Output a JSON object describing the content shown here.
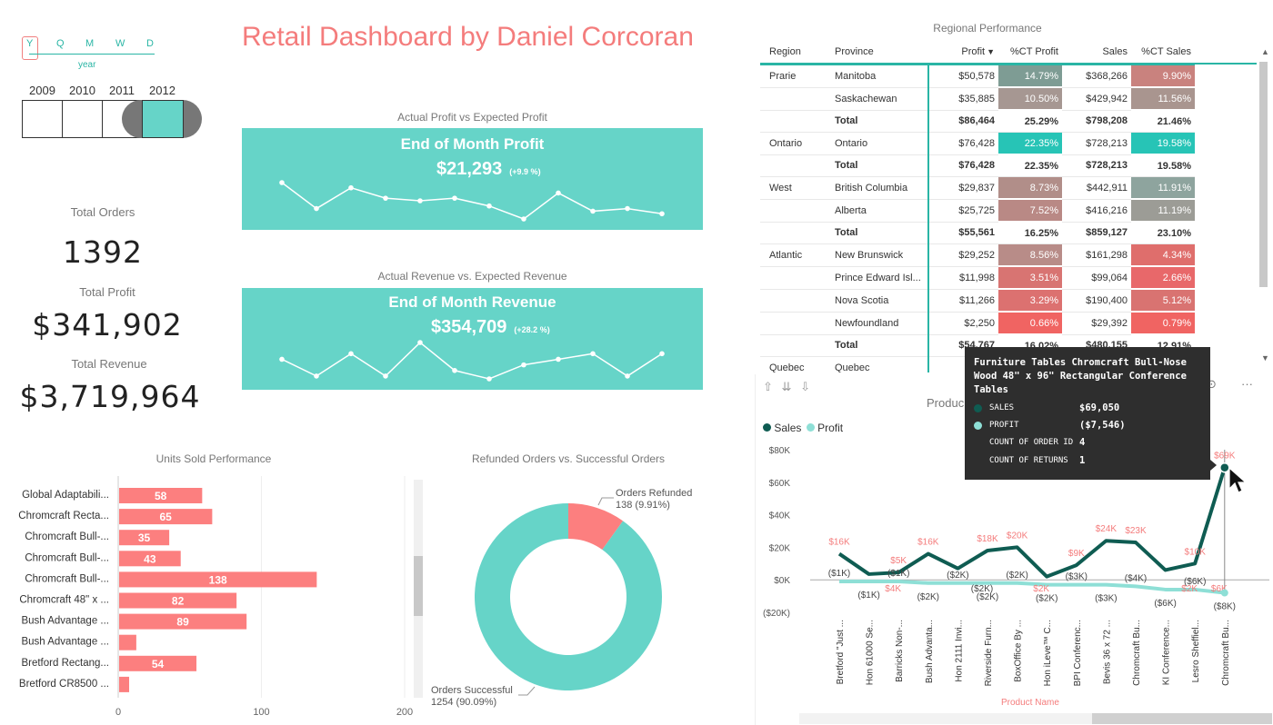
{
  "title": "Retail Dashboard by Daniel Corcoran",
  "time_slicer": {
    "levels": [
      "Y",
      "Q",
      "M",
      "W",
      "D"
    ],
    "level_caption": "year",
    "years": [
      "2009",
      "2010",
      "2011",
      "2012"
    ],
    "selected_year": "2012"
  },
  "kpis": {
    "orders_label": "Total Orders",
    "orders_value": "1392",
    "profit_label": "Total Profit",
    "profit_value": "$341,902",
    "revenue_label": "Total Revenue",
    "revenue_value": "$3,719,964"
  },
  "profit_card": {
    "caption": "Actual Profit vs Expected Profit",
    "heading": "End of Month Profit",
    "value": "$21,293",
    "change": "(+9.9 %)",
    "trend": [
      8,
      3,
      7,
      5,
      4.5,
      5,
      3.5,
      1,
      6,
      2.5,
      3,
      2
    ]
  },
  "revenue_card": {
    "caption": "Actual Revenue vs. Expected Revenue",
    "heading": "End of Month Revenue",
    "value": "$354,709",
    "change": "(+28.2 %)",
    "trend": [
      5,
      2,
      6,
      2,
      8,
      3,
      1.5,
      4,
      5,
      6,
      2,
      6
    ]
  },
  "regional": {
    "title": "Regional Performance",
    "headers": [
      "Region",
      "Province",
      "Profit",
      "%CT Profit",
      "Sales",
      "%CT Sales"
    ],
    "rows": [
      {
        "region": "Prarie",
        "province": "Manitoba",
        "profit": "$50,578",
        "ctp": "14.79%",
        "sales": "$368,266",
        "cts": "9.90%",
        "cp": "#7e9c94",
        "cs": "#c9827e"
      },
      {
        "region": "",
        "province": "Saskachewan",
        "profit": "$35,885",
        "ctp": "10.50%",
        "sales": "$429,942",
        "cts": "11.56%",
        "cp": "#a69792",
        "cs": "#a9958f"
      },
      {
        "region": "",
        "province": "Total",
        "profit": "$86,464",
        "ctp": "25.29%",
        "sales": "$798,208",
        "cts": "21.46%",
        "total": true
      },
      {
        "region": "Ontario",
        "province": "Ontario",
        "profit": "$76,428",
        "ctp": "22.35%",
        "sales": "$728,213",
        "cts": "19.58%",
        "cp": "#27c4b6",
        "cs": "#27c4b6"
      },
      {
        "region": "",
        "province": "Total",
        "profit": "$76,428",
        "ctp": "22.35%",
        "sales": "$728,213",
        "cts": "19.58%",
        "total": true
      },
      {
        "region": "West",
        "province": "British Columbia",
        "profit": "$29,837",
        "ctp": "8.73%",
        "sales": "$442,911",
        "cts": "11.91%",
        "cp": "#b18e89",
        "cs": "#8ea49e"
      },
      {
        "region": "",
        "province": "Alberta",
        "profit": "$25,725",
        "ctp": "7.52%",
        "sales": "$416,216",
        "cts": "11.19%",
        "cp": "#b98985",
        "cs": "#9c9c96"
      },
      {
        "region": "",
        "province": "Total",
        "profit": "$55,561",
        "ctp": "16.25%",
        "sales": "$859,127",
        "cts": "23.10%",
        "total": true
      },
      {
        "region": "Atlantic",
        "province": "New Brunswick",
        "profit": "$29,252",
        "ctp": "8.56%",
        "sales": "$161,298",
        "cts": "4.34%",
        "cp": "#b88c88",
        "cs": "#df6e6c"
      },
      {
        "region": "",
        "province": "Prince Edward Isl...",
        "profit": "$11,998",
        "ctp": "3.51%",
        "sales": "$99,064",
        "cts": "2.66%",
        "cp": "#d87472",
        "cs": "#e8686a"
      },
      {
        "region": "",
        "province": "Nova Scotia",
        "profit": "$11,266",
        "ctp": "3.29%",
        "sales": "$190,400",
        "cts": "5.12%",
        "cp": "#dc7170",
        "cs": "#d97371"
      },
      {
        "region": "",
        "province": "Newfoundland",
        "profit": "$2,250",
        "ctp": "0.66%",
        "sales": "$29,392",
        "cts": "0.79%",
        "cp": "#f06462",
        "cs": "#f06462"
      },
      {
        "region": "",
        "province": "Total",
        "profit": "$54,767",
        "ctp": "16.02%",
        "sales": "$480,155",
        "cts": "12.91%",
        "total": true
      },
      {
        "region": "Quebec",
        "province": "Quebec",
        "profit": "",
        "ctp": "",
        "sales": "",
        "cts": ""
      }
    ]
  },
  "units_sold": {
    "title": "Units Sold Performance",
    "chart_data": {
      "type": "bar",
      "categories": [
        "Global Adaptabili...",
        "Chromcraft Recta...",
        "Chromcraft Bull-...",
        "Chromcraft Bull-...",
        "Chromcraft Bull-...",
        "Chromcraft 48\" x ...",
        "Bush Advantage ...",
        "Bush Advantage ...",
        "Bretford Rectang...",
        "Bretford CR8500 ..."
      ],
      "values": [
        58,
        65,
        35,
        43,
        138,
        82,
        89,
        12,
        54,
        7
      ],
      "data_labels": [
        "58",
        "65",
        "35",
        "43",
        "138",
        "82",
        "89",
        "",
        "54",
        ""
      ],
      "xlim": [
        0,
        200
      ],
      "ticks": [
        "0",
        "100",
        "200"
      ],
      "color": "#fc7f7f"
    }
  },
  "refunds": {
    "title": "Refunded Orders vs. Successful Orders",
    "chart_data": {
      "type": "pie",
      "labels": [
        "Orders Refunded",
        "Orders Successful"
      ],
      "values": [
        138,
        1254
      ],
      "display": [
        "138 (9.91%)",
        "1254 (90.09%)"
      ],
      "colors": [
        "#fc7f7f",
        "#66d4c8"
      ]
    }
  },
  "product_chart": {
    "title": "Produc",
    "legend": [
      "Sales",
      "Profit"
    ],
    "colors": {
      "sales": "#0f5c52",
      "profit": "#8edfd6"
    },
    "y_ticks": [
      "$80K",
      "$60K",
      "$40K",
      "$20K",
      "$0K",
      "($20K)"
    ],
    "x_title": "Product Name",
    "chart_data": {
      "type": "line",
      "categories": [
        "Bretford \"Just ...",
        "Hon 61000 Se...",
        "Barricks Non-...",
        "Bush Advanta...",
        "Hon 2111 Invi...",
        "Riverside Furn...",
        "BoxOffice By ...",
        "Hon iLeve™ C...",
        "BPI Conferenc...",
        "Bevis 36 x 72 ...",
        "Chromcraft Bu...",
        "KI Conference...",
        "Lesro Sheffiel...",
        "Chromcraft Bu..."
      ],
      "series": [
        {
          "name": "Sales",
          "values": [
            16,
            3.5,
            4.5,
            16,
            7,
            18,
            20,
            2,
            9,
            24,
            23,
            6,
            10,
            69
          ],
          "labels": [
            "$16K",
            "",
            "$5K",
            "$16K",
            "",
            "$18K",
            "$20K",
            "",
            "$9K",
            "$24K",
            "$23K",
            "",
            "$10K",
            "$69K"
          ]
        },
        {
          "name": "Profit",
          "values": [
            -1,
            -1,
            -1,
            -2,
            -2,
            -2,
            -2,
            -3,
            -3,
            -3,
            -4,
            -6,
            -6,
            -8
          ],
          "labels": [
            "($1K)",
            "($1K)",
            "($1K)",
            "($2K)",
            "($2K)",
            "($2K)",
            "($2K)",
            "($2K)",
            "($3K)",
            "($3K)",
            "($4K)",
            "($6K)",
            "($6K)",
            "($8K)"
          ]
        }
      ],
      "extra_labels": [
        "$4K",
        "$2K",
        "$2K",
        "($2K)",
        "$6K"
      ],
      "ylim": [
        -20,
        80
      ]
    }
  },
  "tooltip": {
    "title": "Furniture Tables Chromcraft Bull-Nose Wood 48\" x 96\" Rectangular Conference Tables",
    "sales_label": "SALES",
    "sales_value": "$69,050",
    "profit_label": "PROFIT",
    "profit_value": "($7,546)",
    "orders_label": "COUNT OF ORDER ID",
    "orders_value": "4",
    "returns_label": "COUNT OF RETURNS",
    "returns_value": "1"
  }
}
